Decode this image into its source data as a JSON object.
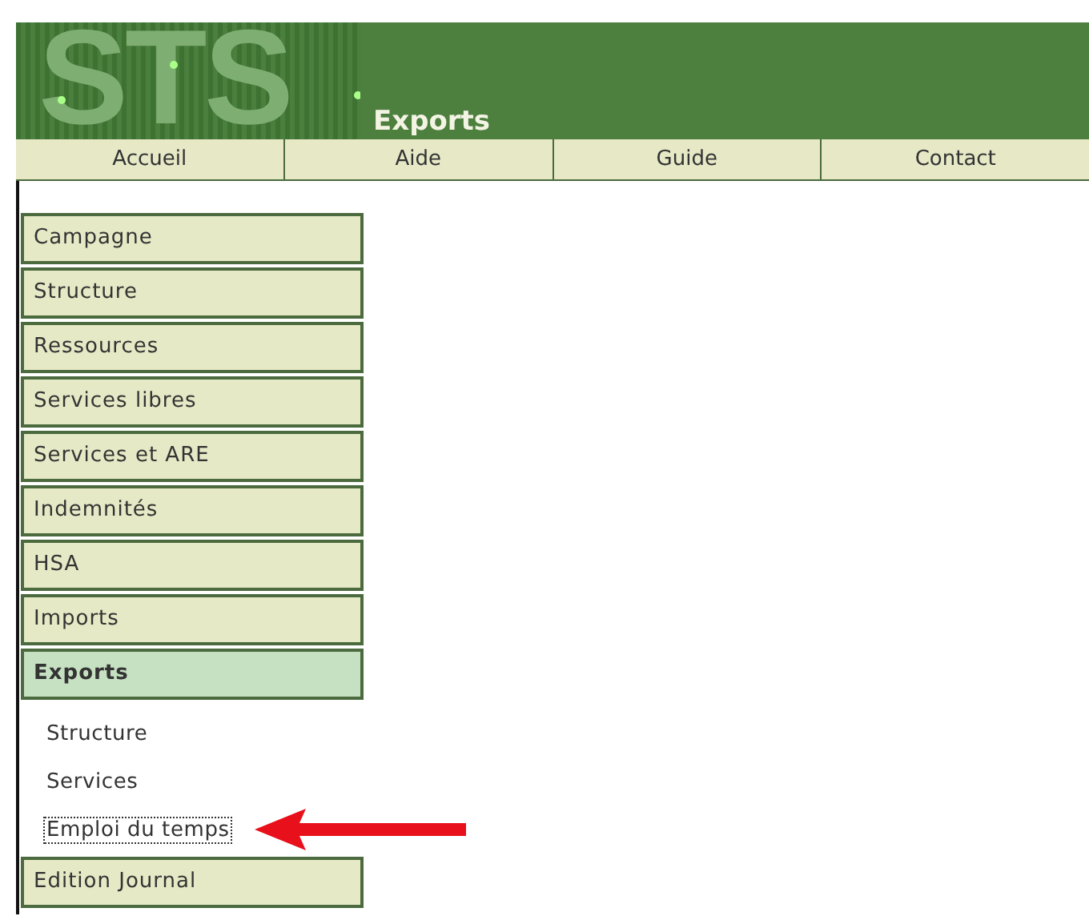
{
  "header": {
    "logo": "STS",
    "title": "Exports"
  },
  "nav": [
    {
      "label": "Accueil"
    },
    {
      "label": "Aide"
    },
    {
      "label": "Guide"
    },
    {
      "label": "Contact"
    }
  ],
  "menu": [
    {
      "label": "Campagne",
      "selected": false
    },
    {
      "label": "Structure",
      "selected": false
    },
    {
      "label": "Ressources",
      "selected": false
    },
    {
      "label": "Services libres",
      "selected": false
    },
    {
      "label": "Services et ARE",
      "selected": false
    },
    {
      "label": "Indemnités",
      "selected": false
    },
    {
      "label": "HSA",
      "selected": false
    },
    {
      "label": "Imports",
      "selected": false
    },
    {
      "label": "Exports",
      "selected": true,
      "children": [
        {
          "label": "Structure",
          "focused": false
        },
        {
          "label": "Services",
          "focused": false
        },
        {
          "label": "Emploi du temps",
          "focused": true,
          "arrow": true
        }
      ]
    },
    {
      "label": "Edition Journal",
      "selected": false
    }
  ]
}
